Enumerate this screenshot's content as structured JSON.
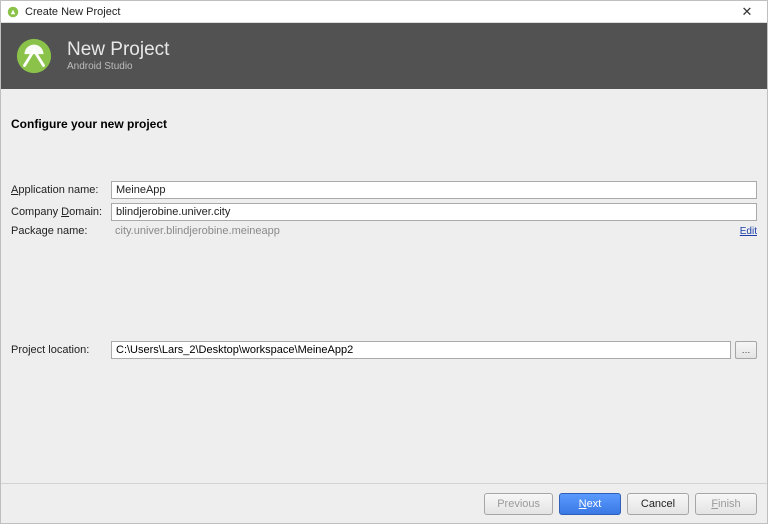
{
  "window": {
    "title": "Create New Project"
  },
  "banner": {
    "title": "New Project",
    "subtitle": "Android Studio"
  },
  "heading": "Configure your new project",
  "labels": {
    "app_name_pre": "",
    "app_name_u": "A",
    "app_name_rest": "pplication name:",
    "company_pre": "Company ",
    "company_u": "D",
    "company_rest": "omain:",
    "package_name": "Package name:",
    "project_location": "Project location:",
    "edit": "Edit",
    "browse": "…"
  },
  "fields": {
    "application_name": "MeineApp",
    "company_domain": "blindjerobine.univer.city",
    "package_name": "city.univer.blindjerobine.meineapp",
    "project_location": "C:\\Users\\Lars_2\\Desktop\\workspace\\MeineApp2"
  },
  "footer": {
    "previous": "Previous",
    "next_u": "N",
    "next_rest": "ext",
    "cancel": "Cancel",
    "finish_u": "F",
    "finish_rest": "inish"
  }
}
